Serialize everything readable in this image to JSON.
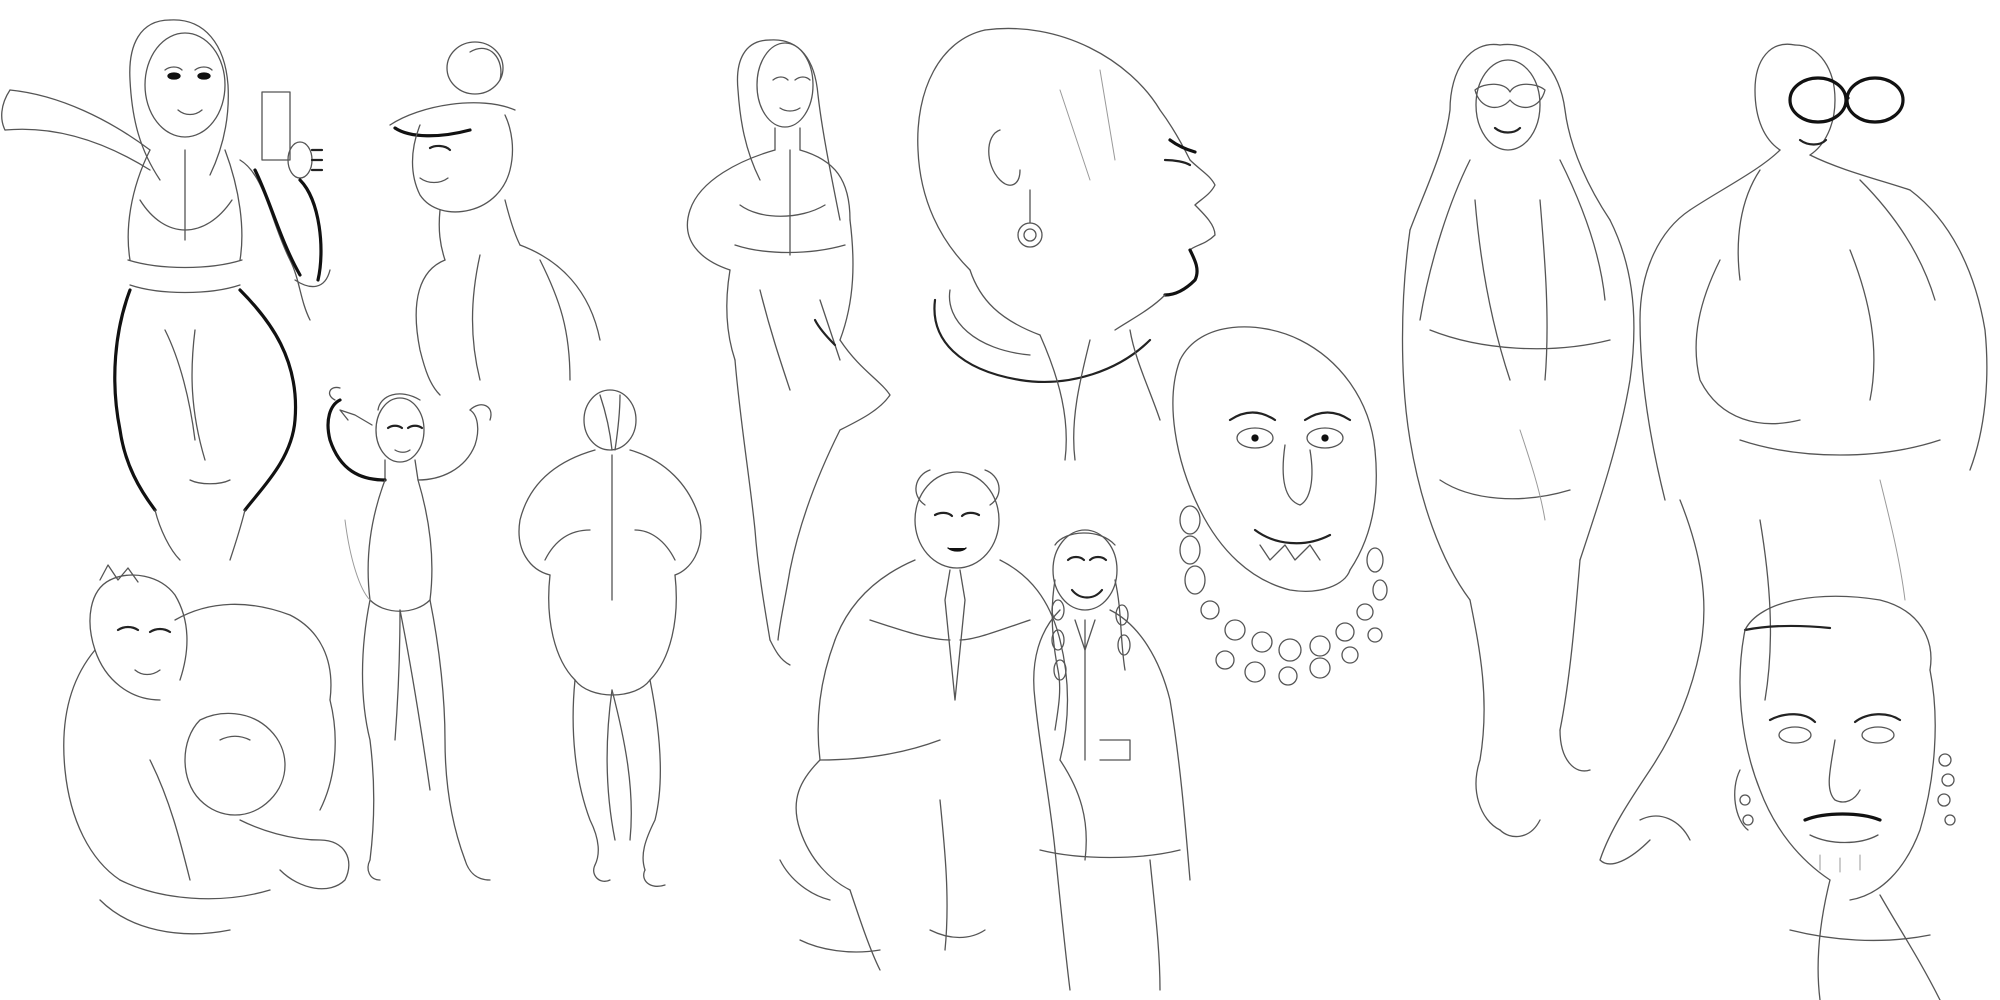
{
  "canvas": {
    "background": "#ffffff",
    "stroke_color": "#555555",
    "accent_stroke": "#111111"
  },
  "figures": [
    {
      "id": "woman-selfie-phone"
    },
    {
      "id": "woman-bun-profile"
    },
    {
      "id": "woman-zip-jumpsuit"
    },
    {
      "id": "bald-head-profile-earring"
    },
    {
      "id": "woman-gold-earrings-beads"
    },
    {
      "id": "woman-sunglasses-coat"
    },
    {
      "id": "man-sunglasses-coat"
    },
    {
      "id": "muscular-man-hunched"
    },
    {
      "id": "woman-flexing-front"
    },
    {
      "id": "woman-back-view"
    },
    {
      "id": "woman-seated-suit-tie"
    },
    {
      "id": "girl-braids-suit"
    },
    {
      "id": "man-face-cap-earring"
    }
  ]
}
